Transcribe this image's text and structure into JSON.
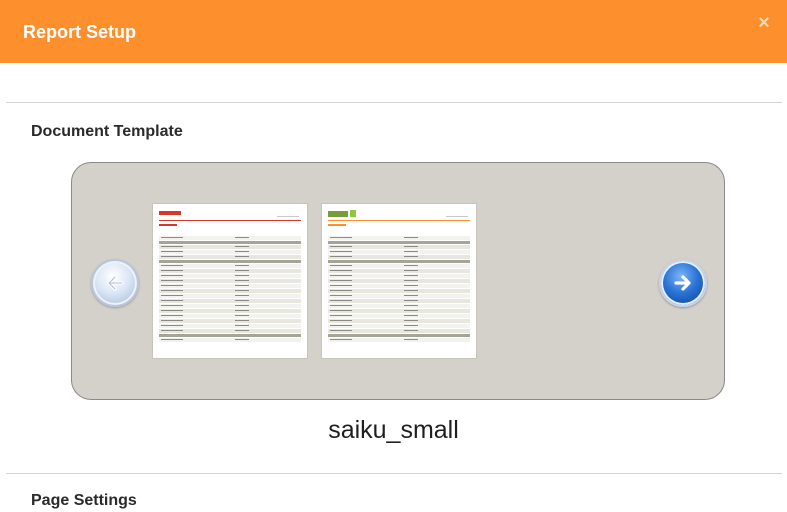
{
  "dialog": {
    "title": "Report Setup",
    "close_glyph": "×"
  },
  "document_template": {
    "heading": "Document Template",
    "selected_name": "saiku_small",
    "templates": [
      {
        "id": "template-1",
        "accent_color": "#d9362b"
      },
      {
        "id": "template-2",
        "accent_color": "#8dc63f"
      }
    ],
    "prev_icon": "arrow-left-icon",
    "next_icon": "arrow-right-icon"
  },
  "page_settings": {
    "heading": "Page Settings"
  },
  "colors": {
    "header_bg": "#fd8f2d",
    "carousel_bg": "#d4d1cb",
    "next_button": "#2a72d6"
  }
}
